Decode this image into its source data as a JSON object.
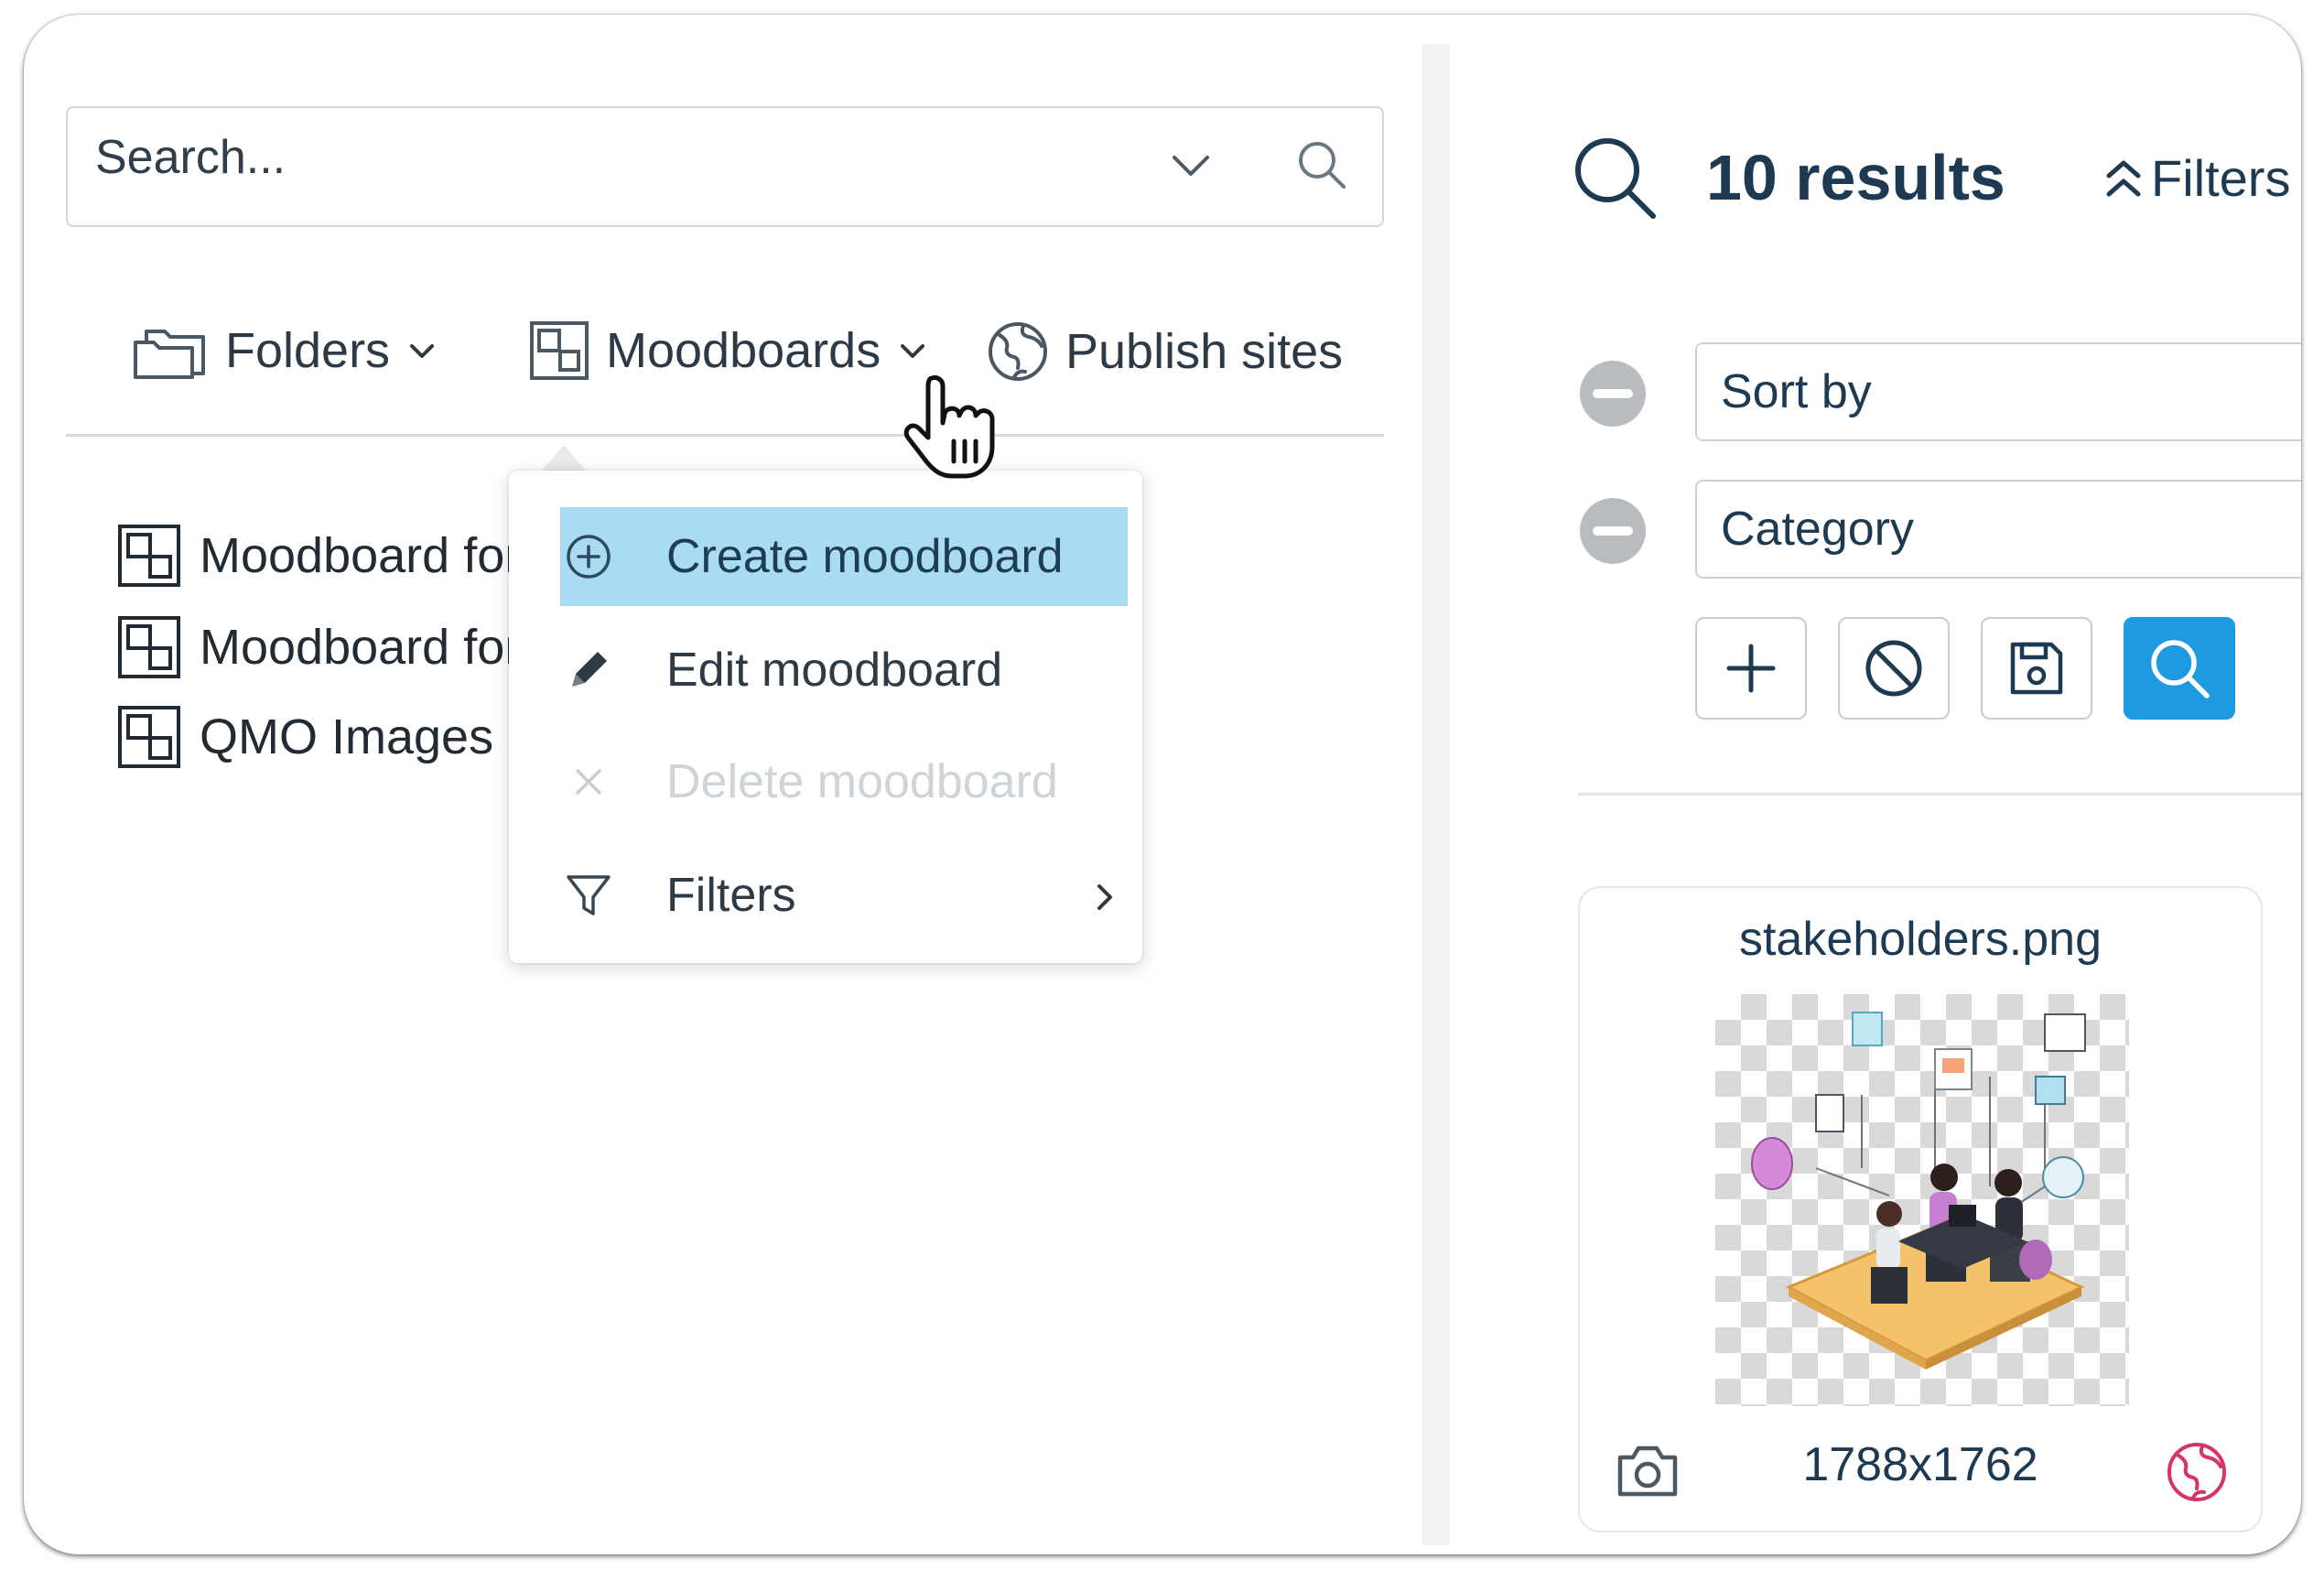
{
  "search": {
    "placeholder": "Search..."
  },
  "tabs": [
    {
      "label": "Folders",
      "icon": "folders-icon"
    },
    {
      "label": "Moodboards",
      "icon": "moodboard-icon"
    },
    {
      "label": "Publish sites",
      "icon": "globe-icon"
    }
  ],
  "tree": {
    "items": [
      {
        "label": "Moodboard for team",
        "icon": "moodboard-icon"
      },
      {
        "label": "Moodboard for project",
        "icon": "moodboard-icon"
      },
      {
        "label": "QMO Images",
        "icon": "moodboard-icon"
      }
    ]
  },
  "menu": {
    "items": [
      {
        "label": "Create moodboard",
        "icon": "plus-circle-icon",
        "state": "highlighted"
      },
      {
        "label": "Edit moodboard",
        "icon": "pencil-icon",
        "state": "enabled"
      },
      {
        "label": "Delete moodboard",
        "icon": "close-icon",
        "state": "disabled"
      },
      {
        "label": "Filters",
        "icon": "filter-icon",
        "state": "enabled",
        "submenu": true
      }
    ]
  },
  "results": {
    "count_label": "10 results",
    "filters_label": "Filters"
  },
  "filters": {
    "fields": [
      {
        "label": "Sort by"
      },
      {
        "label": "Category"
      }
    ],
    "actions": [
      {
        "name": "add-filter",
        "icon": "plus-icon"
      },
      {
        "name": "clear-filters",
        "icon": "block-icon"
      },
      {
        "name": "save-filters",
        "icon": "save-icon"
      },
      {
        "name": "run-search",
        "icon": "search-icon"
      }
    ]
  },
  "card": {
    "filename": "stakeholders.png",
    "dimensions": "1788x1762"
  },
  "colors": {
    "accent": "#1e9be0",
    "highlight": "#a9dcf3",
    "text_dark": "#1d3a52",
    "globe_red": "#d6336c"
  }
}
